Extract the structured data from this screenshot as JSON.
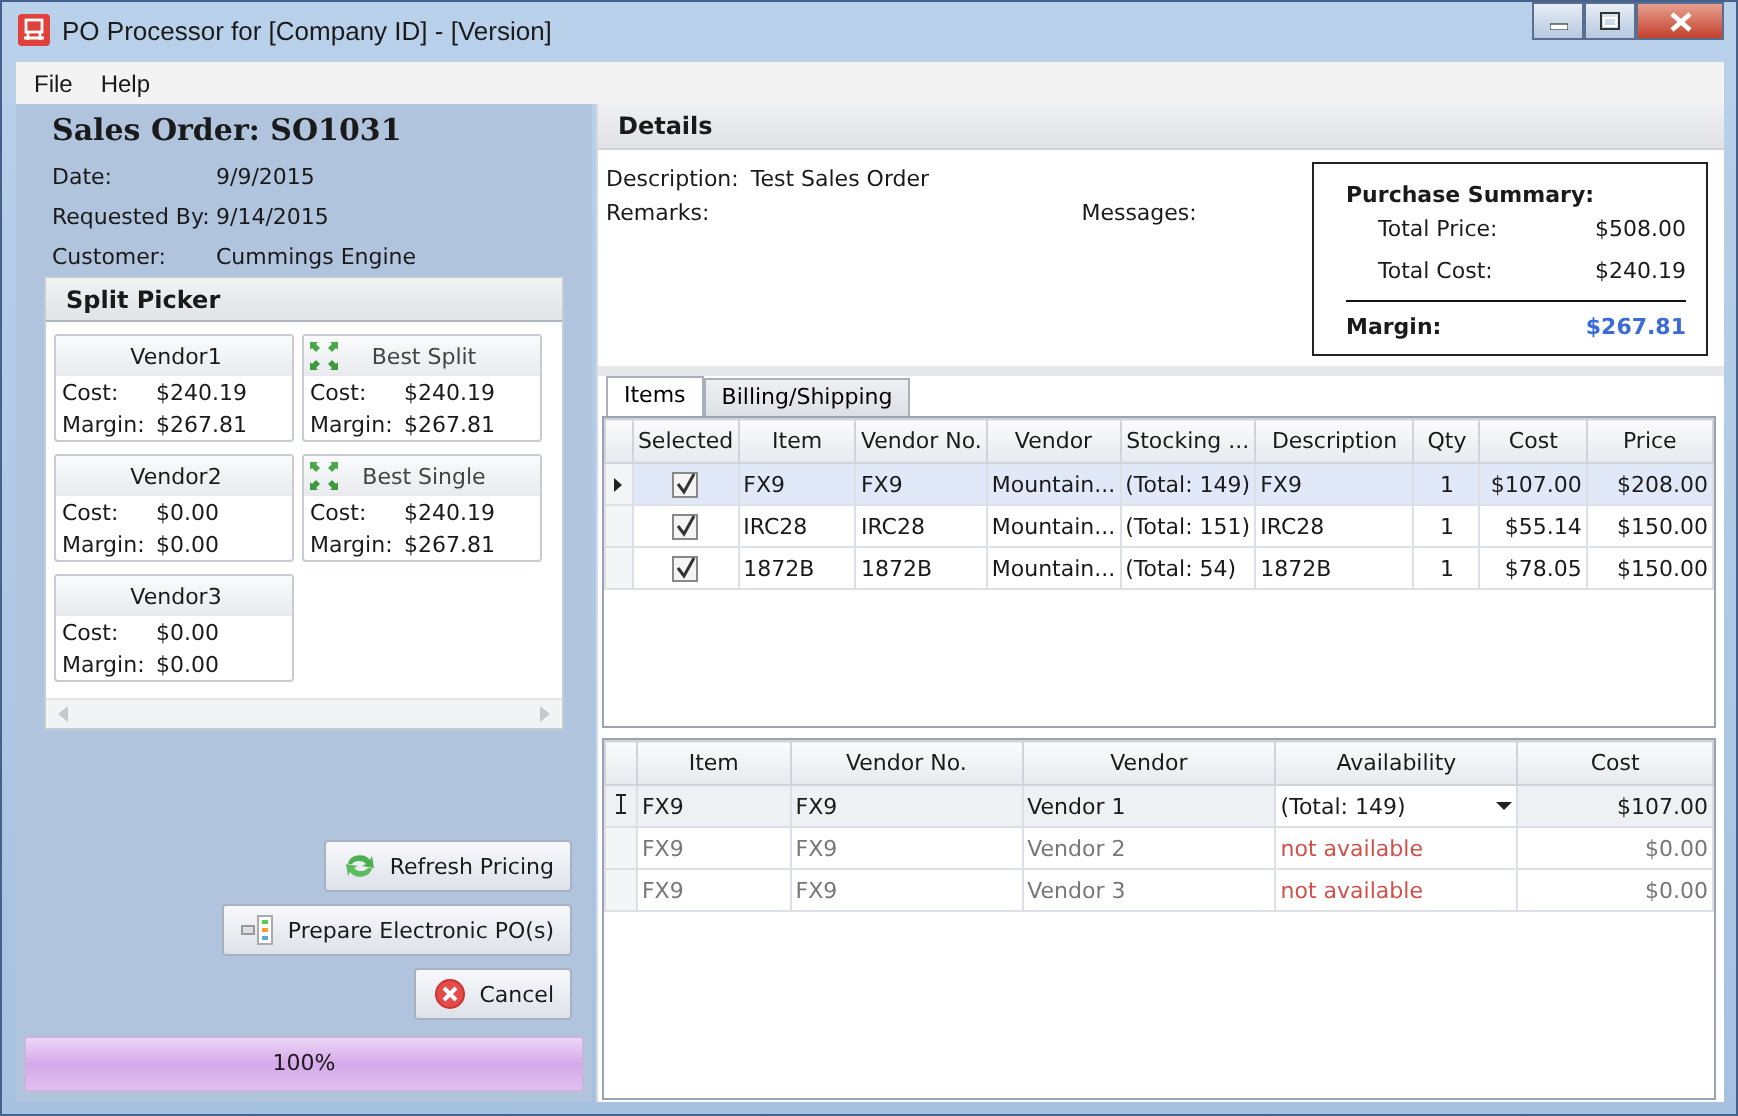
{
  "window": {
    "title": "PO Processor for [Company ID] - [Version]"
  },
  "menu": [
    {
      "label": "File"
    },
    {
      "label": "Help"
    }
  ],
  "sales_order": {
    "title": "Sales Order: SO1031",
    "fields": [
      {
        "label": "Date:",
        "value": "9/9/2015"
      },
      {
        "label": "Requested By:",
        "value": "9/14/2015"
      },
      {
        "label": "Customer:",
        "value": "Cummings Engine"
      }
    ]
  },
  "split_picker": {
    "title": "Split Picker",
    "cards": [
      {
        "kind": "vendor",
        "name": "Vendor1",
        "cost_label": "Cost:",
        "cost": "$240.19",
        "margin_label": "Margin:",
        "margin": "$267.81"
      },
      {
        "kind": "best",
        "name": "Best Split",
        "cost_label": "Cost:",
        "cost": "$240.19",
        "margin_label": "Margin:",
        "margin": "$267.81"
      },
      {
        "kind": "vendor",
        "name": "Vendor2",
        "cost_label": "Cost:",
        "cost": "$0.00",
        "margin_label": "Margin:",
        "margin": "$0.00"
      },
      {
        "kind": "best",
        "name": "Best Single",
        "cost_label": "Cost:",
        "cost": "$240.19",
        "margin_label": "Margin:",
        "margin": "$267.81"
      },
      {
        "kind": "vendor",
        "name": "Vendor3",
        "cost_label": "Cost:",
        "cost": "$0.00",
        "margin_label": "Margin:",
        "margin": "$0.00"
      }
    ]
  },
  "buttons": [
    {
      "kind": "refresh",
      "label": "Refresh Pricing"
    },
    {
      "kind": "prepare",
      "label": "Prepare Electronic PO(s)"
    },
    {
      "kind": "cancel",
      "label": "Cancel"
    }
  ],
  "progress": {
    "level": 1,
    "label": "100%"
  },
  "details": {
    "title": "Details",
    "description_label": "Description:",
    "description": "Test Sales Order",
    "remarks_label": "Remarks:",
    "messages_label": "Messages:",
    "summary": {
      "title": "Purchase Summary:",
      "rows": [
        {
          "label": "Total Price:",
          "value": "$508.00"
        },
        {
          "label": "Total Cost:",
          "value": "$240.19"
        }
      ],
      "margin_label": "Margin:",
      "margin": "$267.81"
    }
  },
  "tabs": [
    {
      "label": "Items",
      "selected": true
    },
    {
      "label": "Billing/Shipping",
      "selected": false
    }
  ],
  "items_table": {
    "columns": [
      "Selected",
      "Item",
      "Vendor No.",
      "Vendor",
      "Stocking ...",
      "Description",
      "Qty",
      "Cost",
      "Price"
    ],
    "rows": [
      {
        "selected": true,
        "cells": [
          {
            "checked": true
          },
          "FX9",
          "FX9",
          "Mountain...",
          "(Total: 149)",
          "FX9",
          "1",
          "$107.00",
          "$208.00"
        ]
      },
      {
        "selected": false,
        "cells": [
          {
            "checked": true
          },
          "IRC28",
          "IRC28",
          "Mountain...",
          "(Total: 151)",
          "IRC28",
          "1",
          "$55.14",
          "$150.00"
        ]
      },
      {
        "selected": false,
        "cells": [
          {
            "checked": true
          },
          "1872B",
          "1872B",
          "Mountain...",
          "(Total: 54)",
          "1872B",
          "1",
          "$78.05",
          "$150.00"
        ]
      }
    ]
  },
  "vendors_table": {
    "columns": [
      "Item",
      "Vendor No.",
      "Vendor",
      "Availability",
      "Cost"
    ],
    "rows": [
      {
        "selected": true,
        "available": true,
        "cells": [
          "FX9",
          "FX9",
          "Vendor 1",
          "(Total: 149)",
          "$107.00"
        ]
      },
      {
        "selected": false,
        "available": false,
        "cells": [
          "FX9",
          "FX9",
          "Vendor 2",
          "not available",
          "$0.00"
        ]
      },
      {
        "selected": false,
        "available": false,
        "cells": [
          "FX9",
          "FX9",
          "Vendor 3",
          "not available",
          "$0.00"
        ]
      }
    ]
  }
}
